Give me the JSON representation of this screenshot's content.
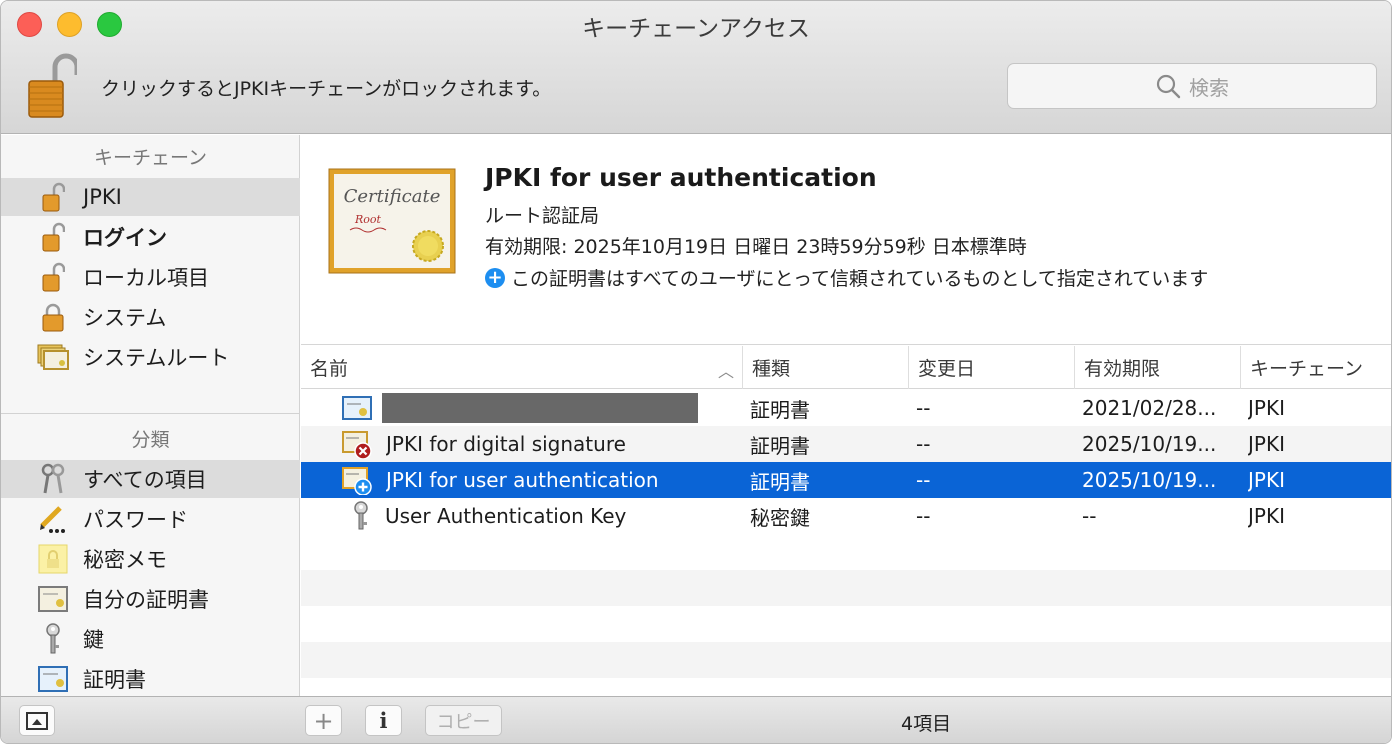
{
  "window": {
    "title": "キーチェーンアクセス"
  },
  "toolbar": {
    "lock_message": "クリックするとJPKIキーチェーンがロックされます。",
    "search_placeholder": "検索"
  },
  "sidebar": {
    "keychains_header": "キーチェーン",
    "keychains": [
      {
        "label": "JPKI",
        "icon": "lock-open-icon",
        "selected": true,
        "bold": false
      },
      {
        "label": "ログイン",
        "icon": "lock-open-icon",
        "selected": false,
        "bold": true
      },
      {
        "label": "ローカル項目",
        "icon": "lock-open-icon",
        "selected": false,
        "bold": false
      },
      {
        "label": "システム",
        "icon": "lock-closed-icon",
        "selected": false,
        "bold": false
      },
      {
        "label": "システムルート",
        "icon": "certificates-icon",
        "selected": false,
        "bold": false
      }
    ],
    "categories_header": "分類",
    "categories": [
      {
        "label": "すべての項目",
        "icon": "keys-icon",
        "selected": true
      },
      {
        "label": "パスワード",
        "icon": "pencil-password-icon",
        "selected": false
      },
      {
        "label": "秘密メモ",
        "icon": "secure-note-icon",
        "selected": false
      },
      {
        "label": "自分の証明書",
        "icon": "my-certificate-icon",
        "selected": false
      },
      {
        "label": "鍵",
        "icon": "key-icon",
        "selected": false
      },
      {
        "label": "証明書",
        "icon": "certificate-icon",
        "selected": false
      }
    ]
  },
  "detail": {
    "cert_image_text": "Certificate",
    "cert_image_subtext": "Root",
    "title": "JPKI for user authentication",
    "kind": "ルート認証局",
    "expires": "有効期限: 2025年10月19日 日曜日 23時59分59秒 日本標準時",
    "trust": "この証明書はすべてのユーザにとって信頼されているものとして指定されています"
  },
  "table": {
    "columns": [
      "名前",
      "種類",
      "変更日",
      "有効期限",
      "キーチェーン"
    ],
    "rows": [
      {
        "name": "",
        "redacted": true,
        "icon": "certificate-icon",
        "kind": "証明書",
        "modified": "--",
        "expires": "2021/02/28...",
        "keychain": "JPKI",
        "selected": false
      },
      {
        "name": "JPKI for digital signature",
        "redacted": false,
        "icon": "certificate-invalid-icon",
        "kind": "証明書",
        "modified": "--",
        "expires": "2025/10/19...",
        "keychain": "JPKI",
        "selected": false
      },
      {
        "name": "JPKI for user authentication",
        "redacted": false,
        "icon": "certificate-trusted-icon",
        "kind": "証明書",
        "modified": "--",
        "expires": "2025/10/19...",
        "keychain": "JPKI",
        "selected": true
      },
      {
        "name": "User Authentication Key",
        "redacted": false,
        "icon": "key-icon",
        "kind": "秘密鍵",
        "modified": "--",
        "expires": "--",
        "keychain": "JPKI",
        "selected": false
      }
    ]
  },
  "bottom": {
    "add_label": "+",
    "info_label": "i",
    "copy_label": "コピー",
    "count": "4項目"
  },
  "colors": {
    "selection": "#0a64d6",
    "accent": "#1d8ef0"
  }
}
